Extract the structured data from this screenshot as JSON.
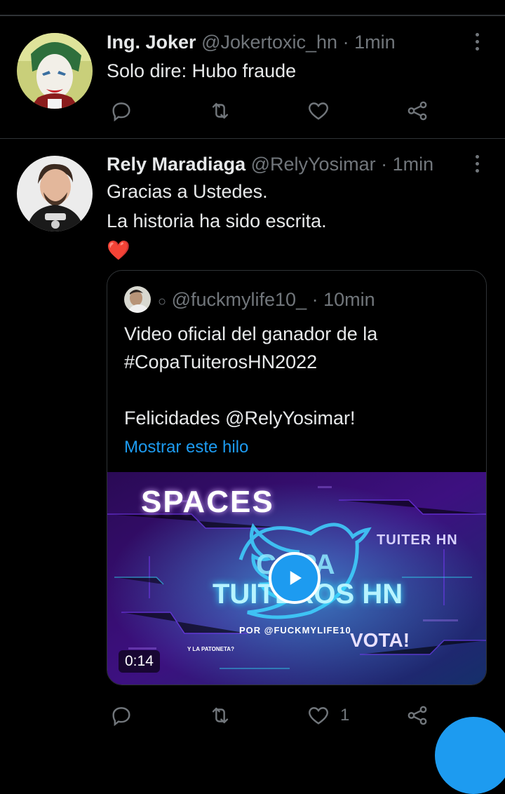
{
  "tweets": [
    {
      "display_name": "Ing. Joker",
      "handle": "@Jokertoxic_hn",
      "separator": " · ",
      "time": "1min",
      "text": "Solo dire: Hubo fraude"
    },
    {
      "display_name": "Rely Maradiaga",
      "handle": "@RelyYosimar",
      "separator": " · ",
      "time": "1min",
      "text_lines": [
        "Gracias a Ustedes.",
        "La historia ha sido escrita."
      ],
      "emoji": "❤️",
      "like_count": "1"
    }
  ],
  "quote": {
    "badge": "○",
    "handle": "@fuckmylife10_",
    "separator": " · ",
    "time": "10min",
    "text_lines": [
      "Video oficial del ganador de la",
      "#CopaTuiterosHN2022",
      "",
      "Felicidades @RelyYosimar!"
    ],
    "show_thread": "Mostrar este hilo",
    "video": {
      "duration": "0:14",
      "title": "SPACES",
      "subtitle_left": "COPA",
      "subtitle_main": "TUITEROS HN",
      "side_label": "TUITER HN",
      "credit": "POR @FUCKMYLIFE10",
      "vote": "VOTA!",
      "small_credit": "Y LA PATONETA?"
    }
  },
  "icons": {
    "reply": "reply-icon",
    "retweet": "retweet-icon",
    "like": "heart-icon",
    "share": "share-icon",
    "more": "more-vertical-icon"
  },
  "colors": {
    "background": "#000000",
    "text": "#e7e9ea",
    "muted": "#71767b",
    "accent": "#1d9bf0",
    "divider": "#2f3336"
  }
}
